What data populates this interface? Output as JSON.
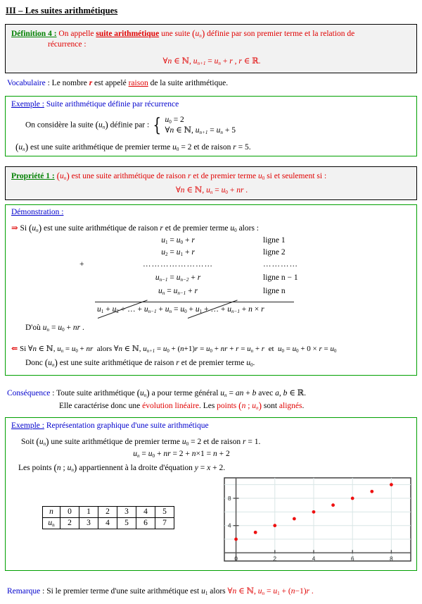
{
  "document": {
    "title": "III – Les suites arithmétiques"
  },
  "definition": {
    "label": "Définition 4 :",
    "text_1": "On appelle ",
    "keyword": "suite arithmétique",
    "text_2": " une suite ",
    "seq": "(u",
    "seq_sub": "n",
    "seq_close": ")",
    "text_3": " définie par son premier terme et la relation de",
    "text_4": "récurrence :",
    "formula": "∀n ∈ ℕ, u(n+1) = u(n) + r , r ∈ ℝ."
  },
  "vocabulaire": {
    "label": "Vocabulaire",
    "colon": " : ",
    "text_1": "Le nombre ",
    "var_r": "r",
    "text_2": " est appelé ",
    "keyword": "raison",
    "text_3": " de la suite arithmétique."
  },
  "exemple1": {
    "label": "Exemple :",
    "title": "Suite arithmétique définie par récurrence",
    "line_1": "On considère la suite ",
    "line_1b": " définie par :",
    "system_row1": "u₀ = 2",
    "system_row2": "∀n ∈ ℕ, u(n+1) = u(n) + 5",
    "line_2a": " est une suite arithmétique de premier terme ",
    "line_2b": "u₀ = 2",
    "line_2c": " et de raison ",
    "line_2d": "r = 5."
  },
  "propriete": {
    "label": "Propriété 1 :",
    "text_1": " est une suite arithmétique de raison ",
    "var_r": "r",
    "text_2": " et de premier terme ",
    "u0": "u₀",
    "text_3": " si et seulement si :",
    "formula": "∀n ∈ ℕ, u(n) = u₀ + n r ."
  },
  "demonstration": {
    "label": "Démonstration :",
    "arrow_direct": "⇒",
    "direct_text_1": " Si ",
    "direct_text_2": " est une suite arithmétique de raison ",
    "direct_text_3": " et de premier terme ",
    "direct_text_4": " alors :",
    "equations": [
      {
        "eq": "u₁ = u₀ + r",
        "line_label": "ligne 1"
      },
      {
        "eq": "u₂ = u₁ + r",
        "line_label": "ligne 2"
      },
      {
        "eq": "……………………",
        "line_label": "…………"
      },
      {
        "eq": "u(n−1) = u(n−2) + r",
        "line_label": "ligne n − 1"
      },
      {
        "eq": "u(n) = u(n−1) + r",
        "line_label": "ligne n"
      }
    ],
    "plus_sign": "+",
    "sum_line": "u₁ + u₂ + … + u(n−1) + u(n) = u₀ + u₁ + … + u(n−1) + n × r",
    "conclusion": "D'où u(n) = u₀ + n r .",
    "arrow_reverse": "⇐",
    "reverse_line": "Si ∀n ∈ ℕ, u(n) = u₀ + n r alors ∀n ∈ ℕ, u(n+1) = u₀ + (n+1)r = u₀ + n r + r = u(n) + r  et  u₀ = u₀ + 0 × r = u₀",
    "reverse_conclusion": "Donc (u(n)) est une suite arithmétique de raison r et de premier terme u₀."
  },
  "consequence": {
    "label": "Conséquence",
    "colon": " : ",
    "text_1": "Toute suite arithmétique ",
    "text_2": " a pour terme général ",
    "formula": "u(n) = a n + b",
    "text_3": " avec ",
    "text_4": "a, b ∈ ℝ.",
    "line2_1": "Elle caractérise donc une ",
    "line2_kw1": "évolution linéaire",
    "line2_2": ". Les ",
    "line2_kw2": "points",
    "line2_3": " (n ; u(n)) ",
    "line2_4": " sont ",
    "line2_kw3": "alignés",
    "line2_5": "."
  },
  "exemple2": {
    "label": "Exemple :",
    "title": "Représentation graphique d'une suite arithmétique",
    "line_1a": "Soit ",
    "line_1b": " une suite arithmétique de premier terme ",
    "line_1c": "u₀ = 2",
    "line_1d": " et de raison ",
    "line_1e": "r = 1.",
    "formula": "u(n) = u₀ + n r = 2 + n × 1 = n + 2",
    "line_2a": "Les points ",
    "line_2b": "(n ; u(n))",
    "line_2c": " appartiennent à la droite d'équation ",
    "line_2d": "y = x + 2."
  },
  "value_table": {
    "row_header_n": "n",
    "row_header_u": "u",
    "row_header_u_sub": "n",
    "n_values": [
      "0",
      "1",
      "2",
      "3",
      "4",
      "5"
    ],
    "u_values": [
      "2",
      "3",
      "4",
      "5",
      "6",
      "7"
    ]
  },
  "remarque": {
    "label": "Remarque",
    "colon": " : ",
    "text_1": "Si le premier terme d'une suite arithmétique est ",
    "u1": "u₁",
    "text_2": " alors ",
    "formula": "∀n ∈ ℕ, u(n) = u₁ + (n − 1) r ."
  },
  "chart_data": {
    "type": "scatter",
    "title": "",
    "xlabel": "",
    "ylabel": "",
    "x": [
      0,
      1,
      2,
      3,
      4,
      5,
      6,
      7,
      8
    ],
    "y": [
      2,
      3,
      4,
      5,
      6,
      7,
      8,
      9,
      10
    ],
    "series": [
      {
        "name": "u(n) = n + 2",
        "values": [
          2,
          3,
          4,
          5,
          6,
          7,
          8,
          9,
          10
        ]
      }
    ],
    "xlim": [
      -0.6,
      9.0
    ],
    "ylim": [
      -1.2,
      11.0
    ],
    "xticks": [
      0,
      2,
      4,
      6,
      8
    ],
    "xtick_labels": [
      "0",
      "2",
      "4",
      "6",
      "8"
    ],
    "yticks": [
      4,
      8
    ],
    "ytick_labels": [
      "4",
      "8"
    ],
    "grid": true,
    "grid_color": "#d9e6e6",
    "point_color": "#ee1111",
    "axis_color": "#555555",
    "frame_color": "#333333",
    "legend": "none"
  },
  "colors": {
    "red": "#e00000",
    "green": "#008000",
    "blue": "#0000cc",
    "box_border_green": "#00a000",
    "box_border_black": "#000000",
    "box_fill_grey": "#f2f2f2"
  }
}
